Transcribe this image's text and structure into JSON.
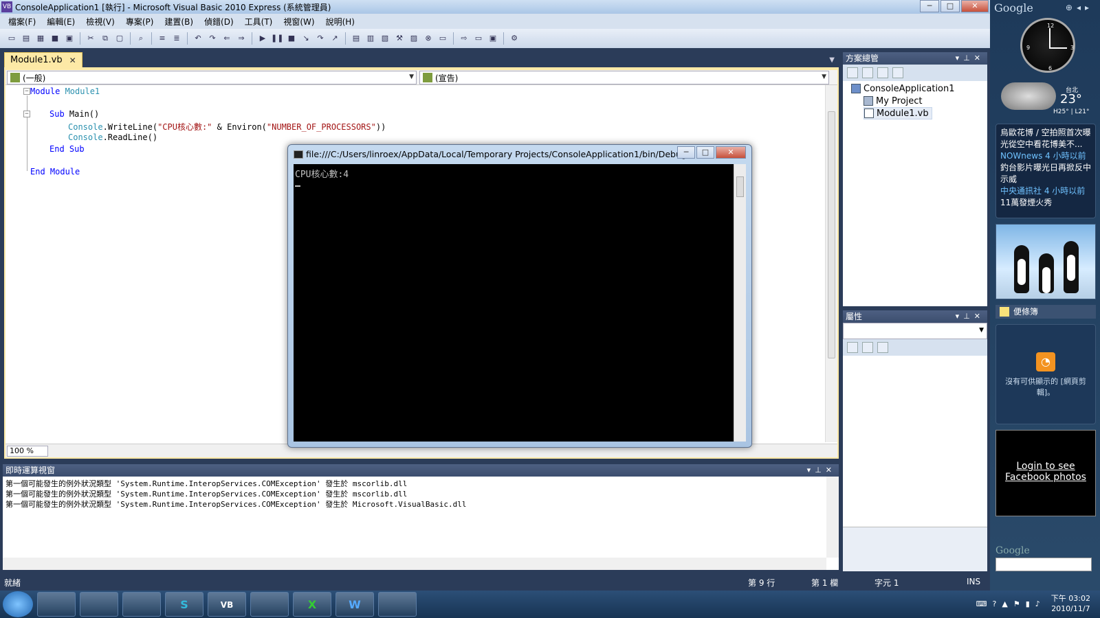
{
  "window": {
    "title": "ConsoleApplication1 [執行] - Microsoft Visual Basic 2010 Express (系統管理員)",
    "app_icon": "VB"
  },
  "menu": [
    "檔案(F)",
    "編輯(E)",
    "檢視(V)",
    "專案(P)",
    "建置(B)",
    "偵錯(D)",
    "工具(T)",
    "視窗(W)",
    "說明(H)"
  ],
  "editor": {
    "tab_label": "Module1.vb",
    "nav_left": "(一般)",
    "nav_right": "(宣告)",
    "zoom": "100 %",
    "code": {
      "l1_kw": "Module",
      "l1_name": " Module1",
      "l2_kw": "Sub",
      "l2_name": " Main()",
      "l3_type": "Console",
      "l3_a": ".WriteLine(",
      "l3_s1": "\"CPU核心數:\"",
      "l3_b": " & Environ(",
      "l3_s2": "\"NUMBER_OF_PROCESSORS\"",
      "l3_c": "))",
      "l4_type": "Console",
      "l4_a": ".ReadLine()",
      "l5_kw": "End Sub",
      "l6_kw": "End Module"
    }
  },
  "solution_explorer": {
    "title": "方案總管",
    "items": [
      "ConsoleApplication1",
      "My Project",
      "Module1.vb"
    ]
  },
  "properties": {
    "title": "屬性"
  },
  "immediate": {
    "title": "即時運算視窗",
    "lines": [
      "第一個可能發生的例外狀況類型 'System.Runtime.InteropServices.COMException' 發生於 mscorlib.dll",
      "第一個可能發生的例外狀況類型 'System.Runtime.InteropServices.COMException' 發生於 mscorlib.dll",
      "第一個可能發生的例外狀況類型 'System.Runtime.InteropServices.COMException' 發生於 Microsoft.VisualBasic.dll"
    ]
  },
  "status": {
    "ready": "就緒",
    "line": "第 9 行",
    "col": "第 1 欄",
    "ch": "字元 1",
    "ins": "INS"
  },
  "console": {
    "title": "file:///C:/Users/linroex/AppData/Local/Temporary Projects/ConsoleApplication1/bin/Debug...",
    "output": "CPU核心數:4"
  },
  "gadgets": {
    "google_logo": "Google",
    "weather": {
      "city": "台北",
      "temp": "23°",
      "hilo": "H25° | L21°"
    },
    "news": [
      {
        "text": "烏歐花博 / 空拍照首次曝光從空中看花博美不...",
        "source": "NOWnews  4 小時以前"
      },
      {
        "text": "釣台影片曝光日再掀反中示威",
        "source": "中央通訊社  4 小時以前"
      },
      {
        "text": "11萬發煙火秀",
        "source": ""
      }
    ],
    "notes": "便條簿",
    "feeds_empty": "沒有可供顯示的 [網頁剪輯]。",
    "facebook": "Login to see Facebook photos",
    "search_logo": "Google"
  },
  "taskbar": {
    "apps": [
      "chrome",
      "explorer",
      "console",
      "skype",
      "vb",
      "yahoo",
      "excel",
      "word",
      "app"
    ],
    "labels": [
      "",
      "",
      "",
      "S",
      "VB",
      "",
      "X",
      "W",
      ""
    ],
    "time": "下午 03:02",
    "date": "2010/11/7"
  }
}
